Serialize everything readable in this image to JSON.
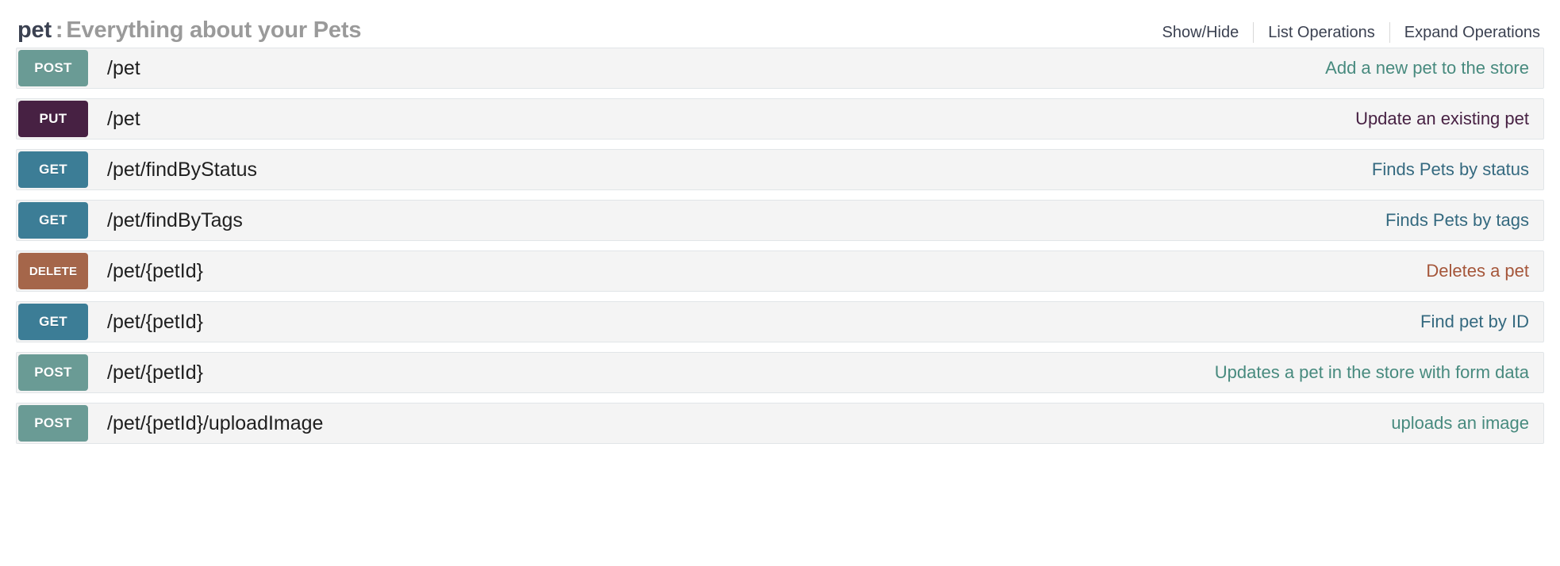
{
  "resource": {
    "tag_name": "pet",
    "separator": ":",
    "tag_description": "Everything about your Pets",
    "options": {
      "show_hide": "Show/Hide",
      "list_operations": "List Operations",
      "expand_operations": "Expand Operations"
    }
  },
  "method_colors": {
    "post": "#6a9b95",
    "put": "#472143",
    "get": "#3c7d96",
    "delete": "#a5664a"
  },
  "summary_colors": {
    "post": "#478a7e",
    "put": "#472143",
    "get": "#34697f",
    "delete": "#a5563a"
  },
  "operations": [
    {
      "method": "POST",
      "method_key": "post",
      "path": "/pet",
      "summary": "Add a new pet to the store"
    },
    {
      "method": "PUT",
      "method_key": "put",
      "path": "/pet",
      "summary": "Update an existing pet"
    },
    {
      "method": "GET",
      "method_key": "get",
      "path": "/pet/findByStatus",
      "summary": "Finds Pets by status"
    },
    {
      "method": "GET",
      "method_key": "get",
      "path": "/pet/findByTags",
      "summary": "Finds Pets by tags"
    },
    {
      "method": "DELETE",
      "method_key": "delete",
      "path": "/pet/{petId}",
      "summary": "Deletes a pet"
    },
    {
      "method": "GET",
      "method_key": "get",
      "path": "/pet/{petId}",
      "summary": "Find pet by ID"
    },
    {
      "method": "POST",
      "method_key": "post",
      "path": "/pet/{petId}",
      "summary": "Updates a pet in the store with form data"
    },
    {
      "method": "POST",
      "method_key": "post",
      "path": "/pet/{petId}/uploadImage",
      "summary": "uploads an image"
    }
  ]
}
